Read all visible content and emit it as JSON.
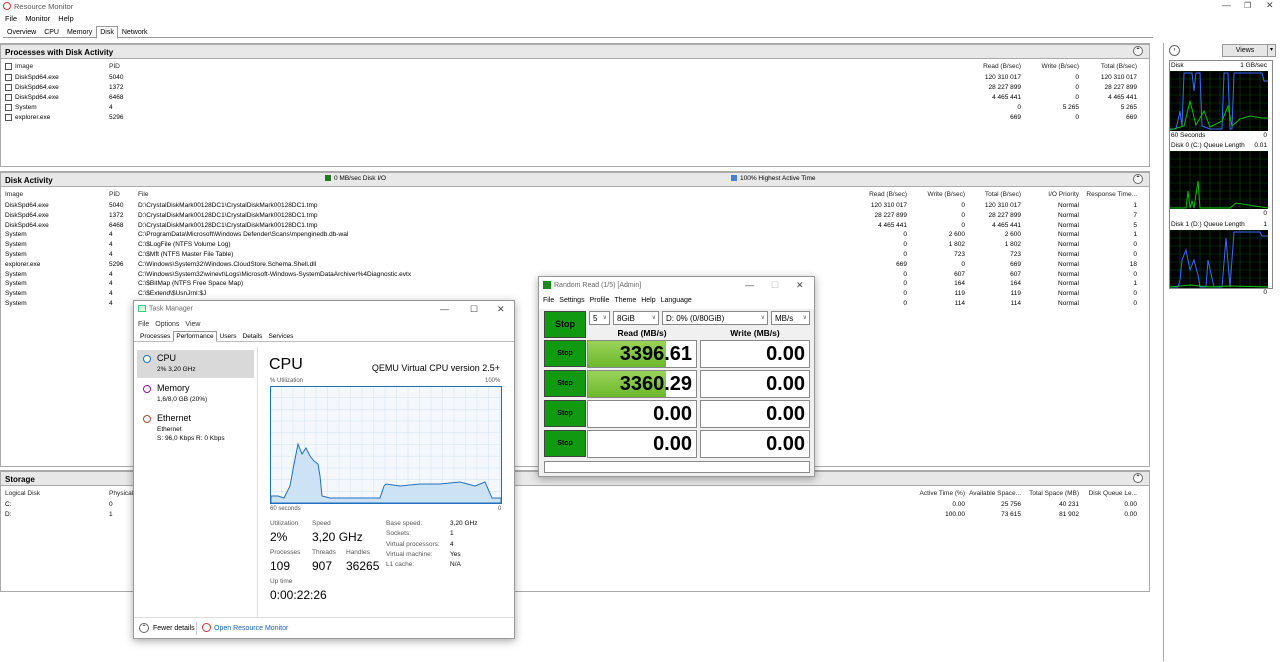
{
  "window": {
    "title": "Resource Monitor",
    "menu": [
      "File",
      "Monitor",
      "Help"
    ],
    "tabs": [
      "Overview",
      "CPU",
      "Memory",
      "Disk",
      "Network"
    ],
    "active_tab": "Disk"
  },
  "processes": {
    "title": "Processes with Disk Activity",
    "columns": [
      "Image",
      "PID",
      "Read (B/sec)",
      "Write (B/sec)",
      "Total (B/sec)"
    ],
    "rows": [
      [
        "DiskSpd64.exe",
        "5040",
        "120 310 017",
        "0",
        "120 310 017"
      ],
      [
        "DiskSpd64.exe",
        "1372",
        "28 227 899",
        "0",
        "28 227 899"
      ],
      [
        "DiskSpd64.exe",
        "6468",
        "4 465 441",
        "0",
        "4 465 441"
      ],
      [
        "System",
        "4",
        "0",
        "5 265",
        "5 265"
      ],
      [
        "explorer.exe",
        "5296",
        "669",
        "0",
        "669"
      ]
    ]
  },
  "disk_activity": {
    "title": "Disk Activity",
    "io_legend": "0 MB/sec Disk I/O",
    "active_legend": "100% Highest Active Time",
    "columns": [
      "Image",
      "PID",
      "File",
      "Read (B/sec)",
      "Write (B/sec)",
      "Total (B/sec)",
      "I/O Priority",
      "Response Time..."
    ],
    "rows": [
      [
        "DiskSpd64.exe",
        "5040",
        "D:\\CrystalDiskMark00128DC1\\CrystalDiskMark00128DC1.tmp",
        "120 310 017",
        "0",
        "120 310 017",
        "Normal",
        "1"
      ],
      [
        "DiskSpd64.exe",
        "1372",
        "D:\\CrystalDiskMark00128DC1\\CrystalDiskMark00128DC1.tmp",
        "28 227 899",
        "0",
        "28 227 899",
        "Normal",
        "7"
      ],
      [
        "DiskSpd64.exe",
        "6468",
        "D:\\CrystalDiskMark00128DC1\\CrystalDiskMark00128DC1.tmp",
        "4 465 441",
        "0",
        "4 465 441",
        "Normal",
        "5"
      ],
      [
        "System",
        "4",
        "C:\\ProgramData\\Microsoft\\Windows Defender\\Scans\\mpenginedb.db-wal",
        "0",
        "2 600",
        "2 600",
        "Normal",
        "1"
      ],
      [
        "System",
        "4",
        "C:\\$LogFile (NTFS Volume Log)",
        "0",
        "1 802",
        "1 802",
        "Normal",
        "0"
      ],
      [
        "System",
        "4",
        "C:\\$Mft (NTFS Master File Table)",
        "0",
        "723",
        "723",
        "Normal",
        "0"
      ],
      [
        "explorer.exe",
        "5296",
        "C:\\Windows\\System32\\Windows.CloudStore.Schema.Shell.dll",
        "669",
        "0",
        "669",
        "Normal",
        "18"
      ],
      [
        "System",
        "4",
        "C:\\Windows\\System32\\winevt\\Logs\\Microsoft-Windows-SystemDataArchiver%4Diagnostic.evtx",
        "0",
        "607",
        "607",
        "Normal",
        "0"
      ],
      [
        "System",
        "4",
        "C:\\$BitMap (NTFS Free Space Map)",
        "0",
        "164",
        "164",
        "Normal",
        "1"
      ],
      [
        "System",
        "4",
        "C:\\$Extend\\$UsnJrnl:$J",
        "0",
        "119",
        "119",
        "Normal",
        "0"
      ],
      [
        "System",
        "4",
        "",
        "0",
        "114",
        "114",
        "Normal",
        "0"
      ]
    ]
  },
  "storage": {
    "title": "Storage",
    "columns": [
      "Logical Disk",
      "Physical",
      "Active Time (%)",
      "Available Space...",
      "Total Space (MB)",
      "Disk Queue Le..."
    ],
    "rows": [
      [
        "C:",
        "0",
        "0.00",
        "25 756",
        "40 231",
        "0.00"
      ],
      [
        "D:",
        "1",
        "100.00",
        "73 615",
        "81 902",
        "0.00"
      ]
    ]
  },
  "side": {
    "views": "Views",
    "graphs": [
      {
        "label": "Disk",
        "right": "1 GB/sec",
        "footer_left": "60 Seconds",
        "footer_right": "0"
      },
      {
        "label": "Disk 0 (C:) Queue Length",
        "right": "0.01",
        "footer_right": "0"
      },
      {
        "label": "Disk 1 (D:) Queue Length",
        "right": "1",
        "footer_right": "0"
      }
    ]
  },
  "taskmgr": {
    "title": "Task Manager",
    "menu": [
      "File",
      "Options",
      "View"
    ],
    "tabs": [
      "Processes",
      "Performance",
      "Users",
      "Details",
      "Services"
    ],
    "active_tab": "Performance",
    "items": [
      {
        "name": "CPU",
        "sub": "2% 3,20 GHz",
        "color": "#1f6fbf"
      },
      {
        "name": "Memory",
        "sub": "1,6/8,0 GB (20%)",
        "color": "#8b1a9b"
      },
      {
        "name": "Ethernet",
        "sub": "Ethernet",
        "sub2": "S: 96,0 Kbps R: 0 Kbps",
        "color": "#a0522d"
      }
    ],
    "heading": "CPU",
    "model": "QEMU Virtual CPU version 2.5+",
    "util_label": "% Utilization",
    "max_label": "100%",
    "time_label": "60 seconds",
    "zero": "0",
    "stats": {
      "util_l": "Utilization",
      "util_v": "2%",
      "speed_l": "Speed",
      "speed_v": "3,20 GHz",
      "proc_l": "Processes",
      "proc_v": "109",
      "thr_l": "Threads",
      "thr_v": "907",
      "hand_l": "Handles",
      "hand_v": "36265",
      "up_l": "Up time",
      "up_v": "0:00:22:26"
    },
    "details": [
      [
        "Base speed:",
        "3,20 GHz"
      ],
      [
        "Sockets:",
        "1"
      ],
      [
        "Virtual processors:",
        "4"
      ],
      [
        "Virtual machine:",
        "Yes"
      ],
      [
        "L1 cache:",
        "N/A"
      ]
    ],
    "fewer": "Fewer details",
    "open_rm": "Open Resource Monitor"
  },
  "cdm": {
    "title": "Random Read (1/5) [Admin]",
    "menu": [
      "File",
      "Settings",
      "Profile",
      "Theme",
      "Help",
      "Language"
    ],
    "count": "5",
    "size": "8GiB",
    "drive": "D: 0% (0/80GiB)",
    "unit": "MB/s",
    "stop": "Stop",
    "read_h": "Read (MB/s)",
    "write_h": "Write (MB/s)",
    "rows": [
      {
        "read": "3396.61",
        "write": "0.00",
        "fill": 0.72
      },
      {
        "read": "3360.29",
        "write": "0.00",
        "fill": 0.72
      },
      {
        "read": "0.00",
        "write": "0.00",
        "fill": 0
      },
      {
        "read": "0.00",
        "write": "0.00",
        "fill": 0
      }
    ]
  },
  "colors": {
    "graph_bg": "#000000",
    "graph_green": "#00c000",
    "graph_blue": "#3b6cff",
    "cdm_green": "#119911"
  }
}
